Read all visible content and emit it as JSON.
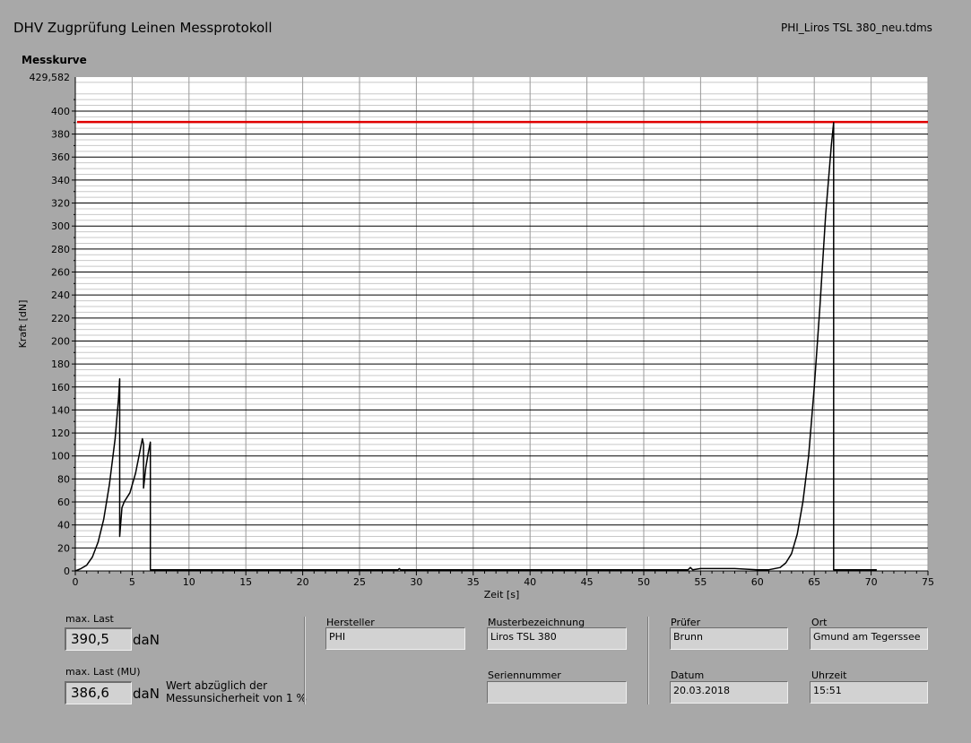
{
  "header": {
    "title": "DHV Zugprüfung Leinen Messprotokoll",
    "filename": "PHI_Liros TSL 380_neu.tdms"
  },
  "chart_heading": "Messkurve",
  "chart_data": {
    "type": "line",
    "xlabel": "Zeit [s]",
    "ylabel": "Kraft [dN]",
    "xlim": [
      0,
      75
    ],
    "ylim": [
      0,
      429.582
    ],
    "y_top_label": "429,582",
    "x_ticks": [
      "0",
      "5",
      "10",
      "15",
      "20",
      "25",
      "30",
      "35",
      "40",
      "45",
      "50",
      "55",
      "60",
      "65",
      "70",
      "75"
    ],
    "y_ticks": [
      "0",
      "20",
      "40",
      "60",
      "80",
      "100",
      "120",
      "140",
      "160",
      "180",
      "200",
      "220",
      "240",
      "260",
      "280",
      "300",
      "320",
      "340",
      "360",
      "380",
      "400"
    ],
    "grid": true,
    "reference_line": {
      "y": 390.5,
      "color": "#e00000"
    },
    "series": [
      {
        "color": "#000000",
        "x": [
          0,
          0.5,
          1.0,
          1.5,
          2.0,
          2.5,
          3.0,
          3.5,
          3.8,
          3.9,
          3.9,
          4.1,
          4.3,
          4.8,
          5.3,
          5.7,
          5.9,
          6.0,
          6.0,
          6.2,
          6.4,
          6.6,
          6.6,
          28.4,
          28.5,
          28.6,
          53.9,
          54.1,
          54.3,
          55.0,
          58.0,
          60.0,
          61.0,
          62.0,
          62.5,
          63.0,
          63.5,
          64.0,
          64.5,
          65.0,
          65.5,
          66.0,
          66.5,
          66.7,
          66.7,
          70.5
        ],
        "y": [
          0,
          2,
          5,
          12,
          25,
          45,
          75,
          115,
          150,
          167,
          30,
          55,
          60,
          68,
          85,
          105,
          115,
          110,
          72,
          90,
          102,
          112,
          1,
          1,
          2,
          1,
          1,
          3,
          1,
          2,
          2,
          1,
          1,
          3,
          7,
          15,
          32,
          60,
          100,
          160,
          230,
          310,
          370,
          390,
          1,
          1
        ]
      }
    ]
  },
  "bottom": {
    "max_last": {
      "label": "max. Last",
      "value": "390,5",
      "unit": "daN"
    },
    "max_last_mu": {
      "label": "max. Last (MU)",
      "value": "386,6",
      "unit": "daN",
      "note1": "Wert abzüglich der",
      "note2": "Messunsicherheit von 1 %"
    },
    "hersteller": {
      "label": "Hersteller",
      "value": "PHI"
    },
    "muster": {
      "label": "Musterbezeichnung",
      "value": "Liros TSL 380"
    },
    "serien": {
      "label": "Seriennummer",
      "value": ""
    },
    "pruefer": {
      "label": "Prüfer",
      "value": "Brunn"
    },
    "ort": {
      "label": "Ort",
      "value": "Gmund am Tegerssee"
    },
    "datum": {
      "label": "Datum",
      "value": "20.03.2018"
    },
    "uhrzeit": {
      "label": "Uhrzeit",
      "value": "15:51"
    }
  }
}
